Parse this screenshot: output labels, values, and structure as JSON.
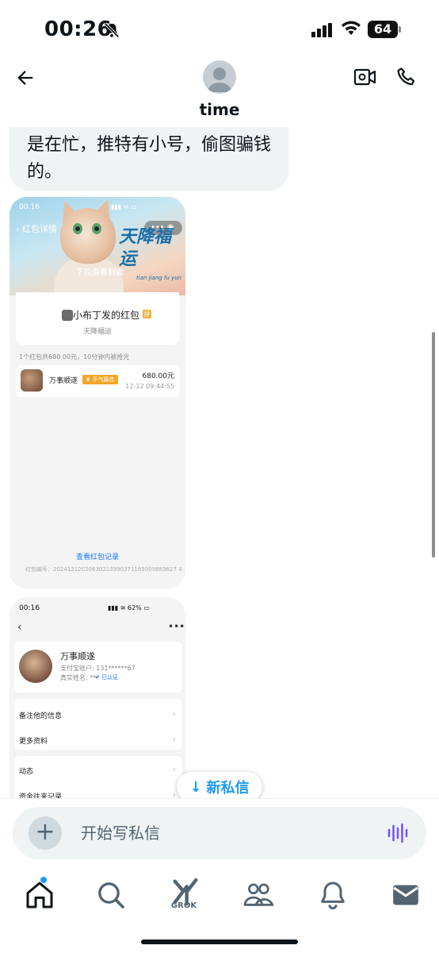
{
  "status_bar": {
    "time": "00:26",
    "battery": "64"
  },
  "header": {
    "title": "time"
  },
  "message": {
    "text": "是在忙，推特有小号，偷图骗钱的。"
  },
  "image1": {
    "status_time": "00:16",
    "page_title": "红包详情",
    "more": "•••",
    "calligraphy": "天降福运",
    "pinyin": "tian jiang fu yun",
    "pull_hint": "下拉查看封面",
    "sender_title": "小布丁发的红包",
    "pin_badge": "拼",
    "blessing": "天降福运",
    "summary": "1个红包共680.00元，10分钟内被抢光",
    "receiver_name": "万事顺遂",
    "luck_badge": "手气最佳",
    "amount": "680.00元",
    "time": "12-12 09:44:55",
    "record_link": "查看红包记录",
    "serial": "红包编号：20241212020630213990371165009883627 4"
  },
  "image2": {
    "status_time": "00:16",
    "status_right": "62%",
    "name": "万事顺遂",
    "account": "支付宝账户: 131******67",
    "real_name": "真实姓名: ***",
    "verified": "已认证",
    "items": [
      "备注他的信息",
      "更多资料",
      "动态",
      "资金往来记录"
    ]
  },
  "new_pill": {
    "label": "新私信"
  },
  "composer": {
    "placeholder": "开始写私信"
  },
  "tabbar": {
    "grok_label": "GROK"
  },
  "colors": {
    "accent": "#1d9bf0",
    "bubble_bg": "#eff3f4",
    "voice": "#7856ff"
  }
}
